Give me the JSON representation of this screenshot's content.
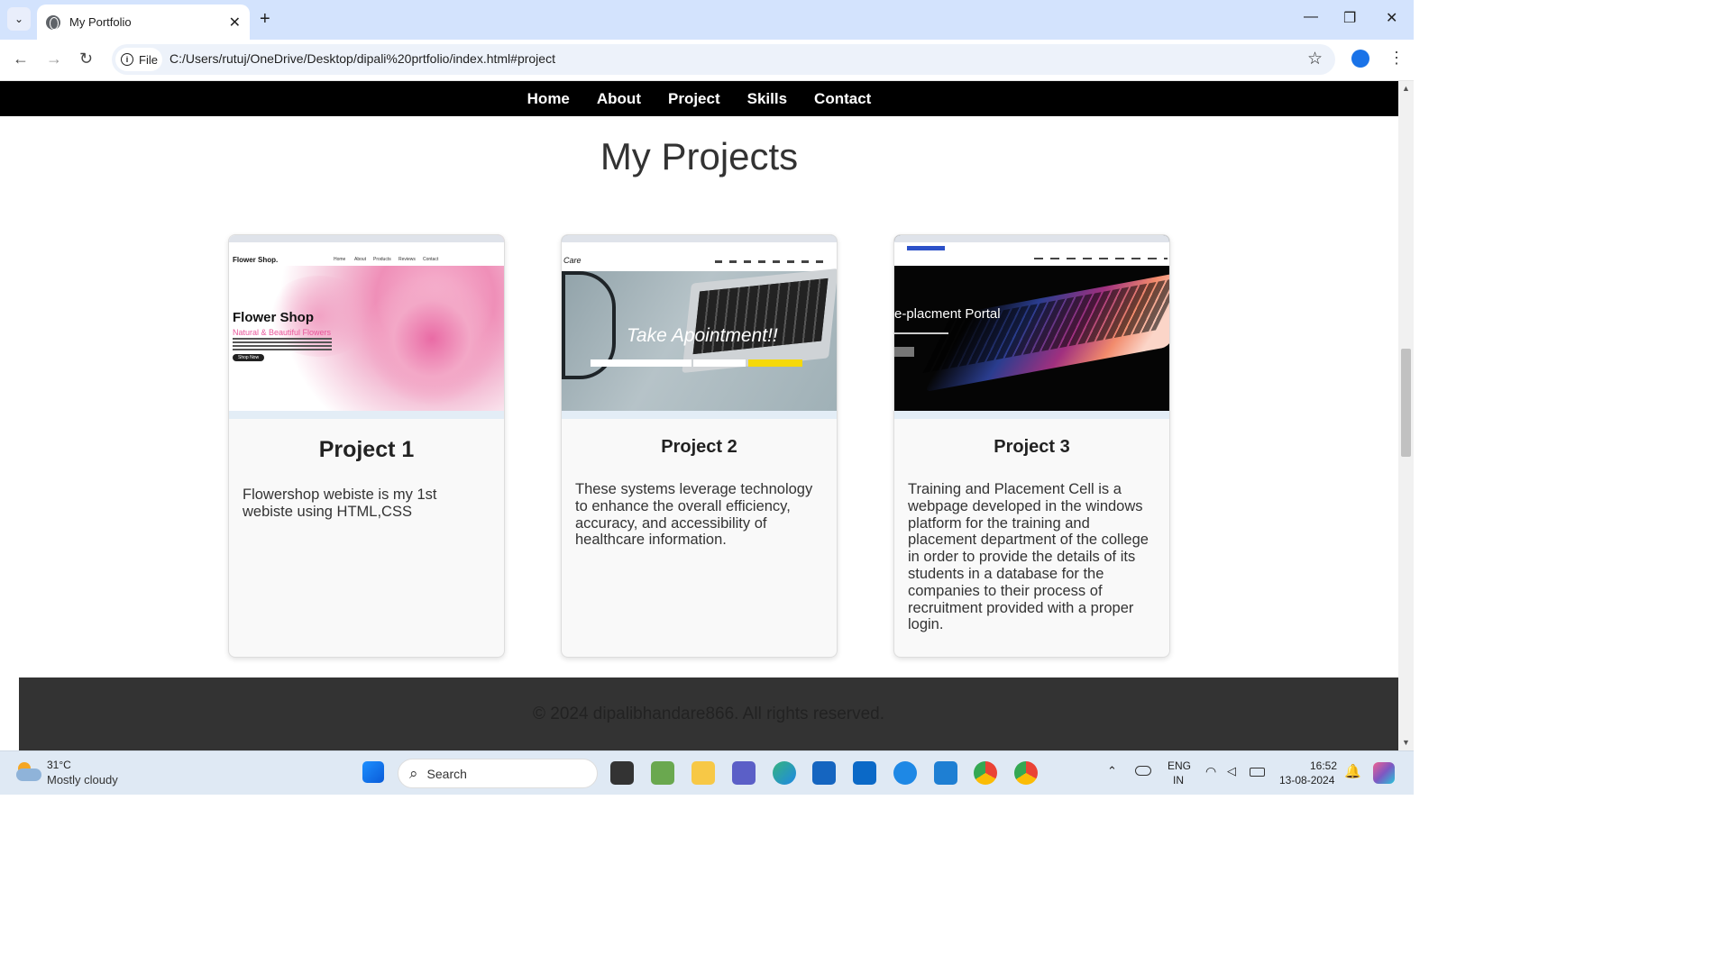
{
  "browser": {
    "tab_title": "My Portfolio",
    "new_tab_symbol": "+",
    "tab_close_symbol": "✕",
    "url": "C:/Users/rutuj/OneDrive/Desktop/dipali%20prtfolio/index.html#project",
    "scheme_chip": "File"
  },
  "site": {
    "nav": [
      "Home",
      "About",
      "Project",
      "Skills",
      "Contact"
    ],
    "section_title": "My Projects",
    "projects": [
      {
        "title": "Project 1",
        "description": "Flowershop webiste is my 1st webiste using HTML,CSS",
        "thumb": {
          "brand": "Flower Shop.",
          "menu": [
            "Home",
            "About",
            "Products",
            "Reviews",
            "Contact"
          ],
          "hero_title": "Flower Shop",
          "hero_sub": "Natural & Beautiful Flowers",
          "button": "Shop Now"
        }
      },
      {
        "title": "Project 2",
        "description": "These systems leverage technology to enhance the overall efficiency, accuracy, and accessibility of healthcare information.",
        "thumb": {
          "brand": "Care",
          "hero_title": "Take Apointment!!"
        }
      },
      {
        "title": "Project 3",
        "description": "Training and Placement Cell is a webpage developed in the windows platform for the training and placement department of the college in order to provide the details of its students in a database for the companies to their process of recruitment provided with a proper login.",
        "thumb": {
          "hero_title": "e-placment Portal"
        }
      }
    ],
    "footer": "© 2024 dipalibhandare866. All rights reserved."
  },
  "taskbar": {
    "weather_temp": "31°C",
    "weather_desc": "Mostly cloudy",
    "search_placeholder": "Search",
    "lang_top": "ENG",
    "lang_bottom": "IN",
    "time": "16:52",
    "date": "13-08-2024"
  },
  "colors": {
    "nav_bg": "#000000",
    "footer_bg": "#333333",
    "card_bg": "#f9f9f9",
    "chrome_tabstrip": "#d3e3fd",
    "flower_pink": "#e8559a",
    "p2_button_yellow": "#f5d90a"
  }
}
